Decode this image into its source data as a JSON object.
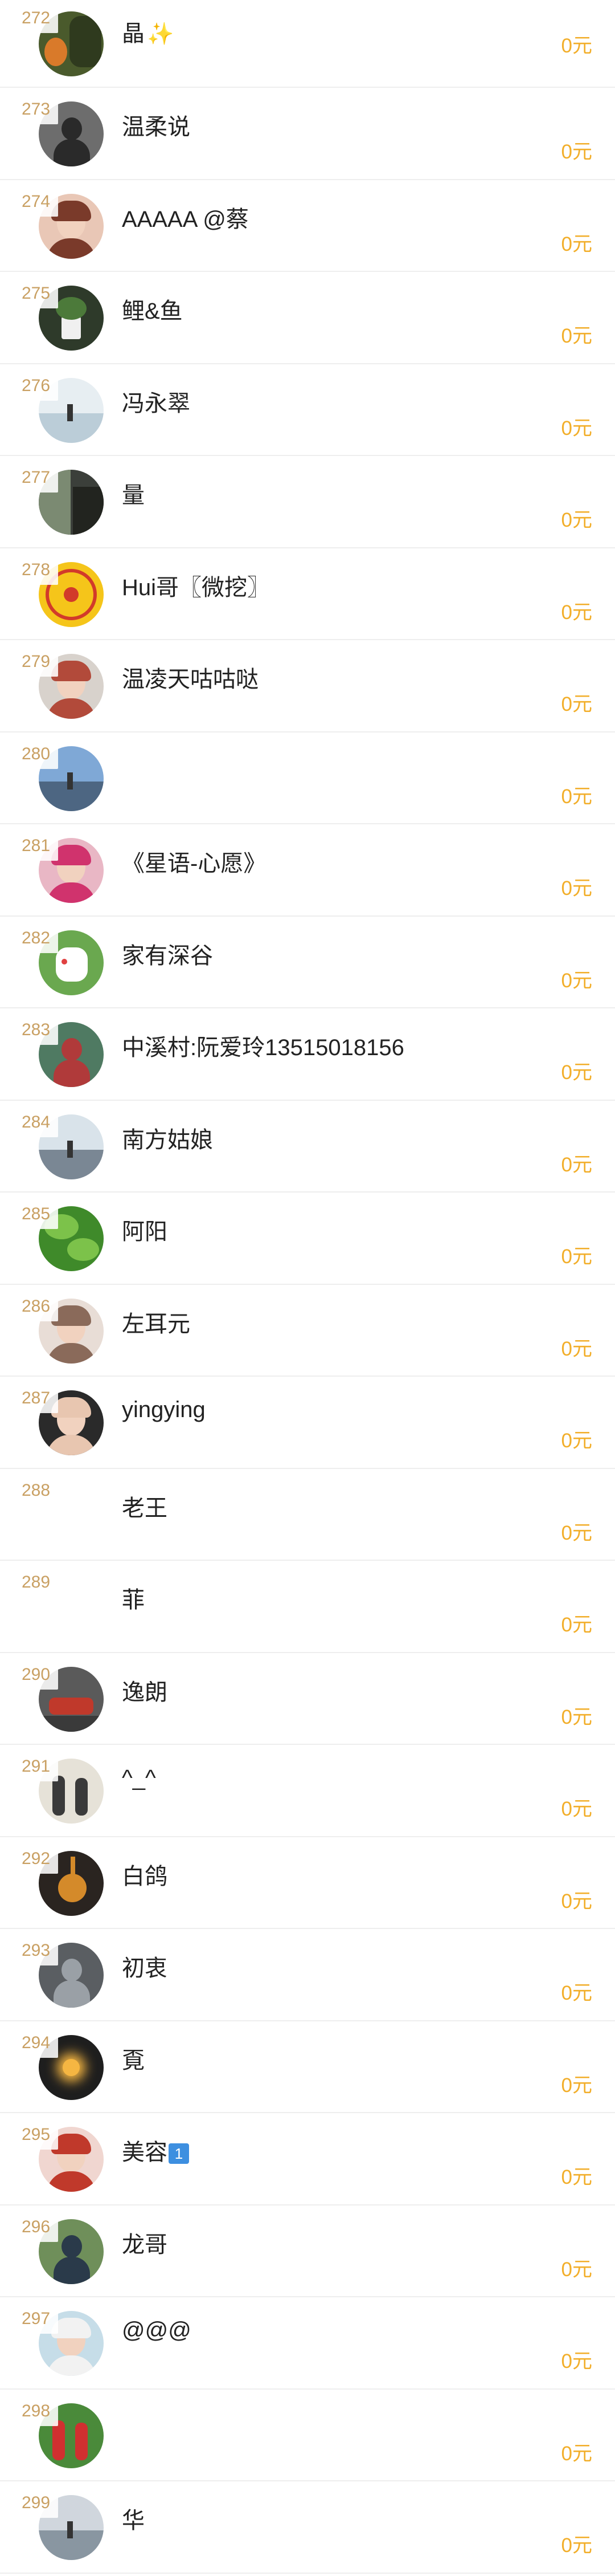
{
  "currency_suffix": "元",
  "rows": [
    {
      "rank": "272",
      "name": "晶",
      "name_suffix": "✨",
      "amount": "0元",
      "avatar": {
        "bg": "#4a5a2c",
        "accent": "#d97a2a",
        "kind": "orange-photo"
      }
    },
    {
      "rank": "273",
      "name": "温柔说",
      "amount": "0元",
      "avatar": {
        "bg": "#6d6d6d",
        "accent": "#2a2a2a",
        "kind": "person-dark"
      }
    },
    {
      "rank": "274",
      "name": "AAAAA @蔡",
      "amount": "0元",
      "avatar": {
        "bg": "#e9c7b6",
        "accent": "#7a3a2a",
        "kind": "face"
      }
    },
    {
      "rank": "275",
      "name": "鲤&鱼",
      "amount": "0元",
      "avatar": {
        "bg": "#2e3a2a",
        "accent": "#f0f0f0",
        "kind": "plant"
      }
    },
    {
      "rank": "276",
      "name": "冯永翠",
      "amount": "0元",
      "avatar": {
        "bg": "#e7eef2",
        "accent": "#9fb7c6",
        "kind": "mist"
      }
    },
    {
      "rank": "277",
      "name": "量",
      "amount": "0元",
      "avatar": {
        "bg": "#3b3f3a",
        "accent": "#7b8a72",
        "kind": "cliff"
      }
    },
    {
      "rank": "278",
      "name": "Hui哥〖微挖〗",
      "amount": "0元",
      "avatar": {
        "bg": "#f5c51a",
        "accent": "#d23a2a",
        "kind": "wheel"
      }
    },
    {
      "rank": "279",
      "name": "温凌天咕咕哒",
      "amount": "0元",
      "avatar": {
        "bg": "#d8d2cc",
        "accent": "#b24a3a",
        "kind": "child"
      }
    },
    {
      "rank": "280",
      "name": "",
      "amount": "0元",
      "avatar": {
        "bg": "#7fa8d6",
        "accent": "#2b3b4a",
        "kind": "sky"
      }
    },
    {
      "rank": "281",
      "name": "《星语-心愿》",
      "amount": "0元",
      "avatar": {
        "bg": "#e9b7c5",
        "accent": "#d0336d",
        "kind": "face"
      }
    },
    {
      "rank": "282",
      "name": "家有深谷",
      "amount": "0元",
      "avatar": {
        "bg": "#6aa84f",
        "accent": "#e04040",
        "kind": "cat"
      }
    },
    {
      "rank": "283",
      "name": "中溪村:阮爱玲13515018156",
      "amount": "0元",
      "avatar": {
        "bg": "#4f7a62",
        "accent": "#b03a3a",
        "kind": "person-dark"
      }
    },
    {
      "rank": "284",
      "name": "南方姑娘",
      "amount": "0元",
      "avatar": {
        "bg": "#d9e3ea",
        "accent": "#3a4a5a",
        "kind": "sky"
      }
    },
    {
      "rank": "285",
      "name": "阿阳",
      "amount": "0元",
      "avatar": {
        "bg": "#3f8a2a",
        "accent": "#7cc24a",
        "kind": "leaves"
      }
    },
    {
      "rank": "286",
      "name": "左耳元",
      "amount": "0元",
      "avatar": {
        "bg": "#e8ddd6",
        "accent": "#8a6a5a",
        "kind": "anime"
      }
    },
    {
      "rank": "287",
      "name": "yingying",
      "amount": "0元",
      "avatar": {
        "bg": "#2a2a2a",
        "accent": "#e8c6b0",
        "kind": "face"
      }
    },
    {
      "rank": "288",
      "name": "老王",
      "amount": "0元",
      "avatar": {
        "bg": "#ffffff",
        "accent": "#ffffff",
        "kind": "blank"
      }
    },
    {
      "rank": "289",
      "name": "菲",
      "amount": "0元",
      "avatar": {
        "bg": "#ffffff",
        "accent": "#ffffff",
        "kind": "blank"
      }
    },
    {
      "rank": "290",
      "name": "逸朗",
      "amount": "0元",
      "avatar": {
        "bg": "#5a5a5a",
        "accent": "#c0392b",
        "kind": "car"
      }
    },
    {
      "rank": "291",
      "name": "^_^",
      "amount": "0元",
      "avatar": {
        "bg": "#e6e2d8",
        "accent": "#3a3a3a",
        "kind": "people"
      }
    },
    {
      "rank": "292",
      "name": "白鸽",
      "amount": "0元",
      "avatar": {
        "bg": "#2a2420",
        "accent": "#d48a2a",
        "kind": "guitar"
      }
    },
    {
      "rank": "293",
      "name": "初衷",
      "amount": "0元",
      "avatar": {
        "bg": "#5a5e62",
        "accent": "#9aa0a6",
        "kind": "person-dark"
      }
    },
    {
      "rank": "294",
      "name": "覔",
      "amount": "0元",
      "avatar": {
        "bg": "#1e1e1e",
        "accent": "#f5b642",
        "kind": "firework"
      }
    },
    {
      "rank": "295",
      "name": "美容",
      "name_badge": "1",
      "amount": "0元",
      "avatar": {
        "bg": "#f0d6d0",
        "accent": "#c0392b",
        "kind": "face"
      }
    },
    {
      "rank": "296",
      "name": "龙哥",
      "amount": "0元",
      "avatar": {
        "bg": "#6f8f5a",
        "accent": "#2a3a4a",
        "kind": "person-dark"
      }
    },
    {
      "rank": "297",
      "name": "@@@",
      "amount": "0元",
      "avatar": {
        "bg": "#c6dde8",
        "accent": "#f2f2f2",
        "kind": "child"
      }
    },
    {
      "rank": "298",
      "name": "",
      "amount": "0元",
      "avatar": {
        "bg": "#4a8a3a",
        "accent": "#d03030",
        "kind": "people"
      }
    },
    {
      "rank": "299",
      "name": "华",
      "amount": "0元",
      "avatar": {
        "bg": "#d0d6dd",
        "accent": "#5a6a7a",
        "kind": "mist"
      }
    }
  ]
}
